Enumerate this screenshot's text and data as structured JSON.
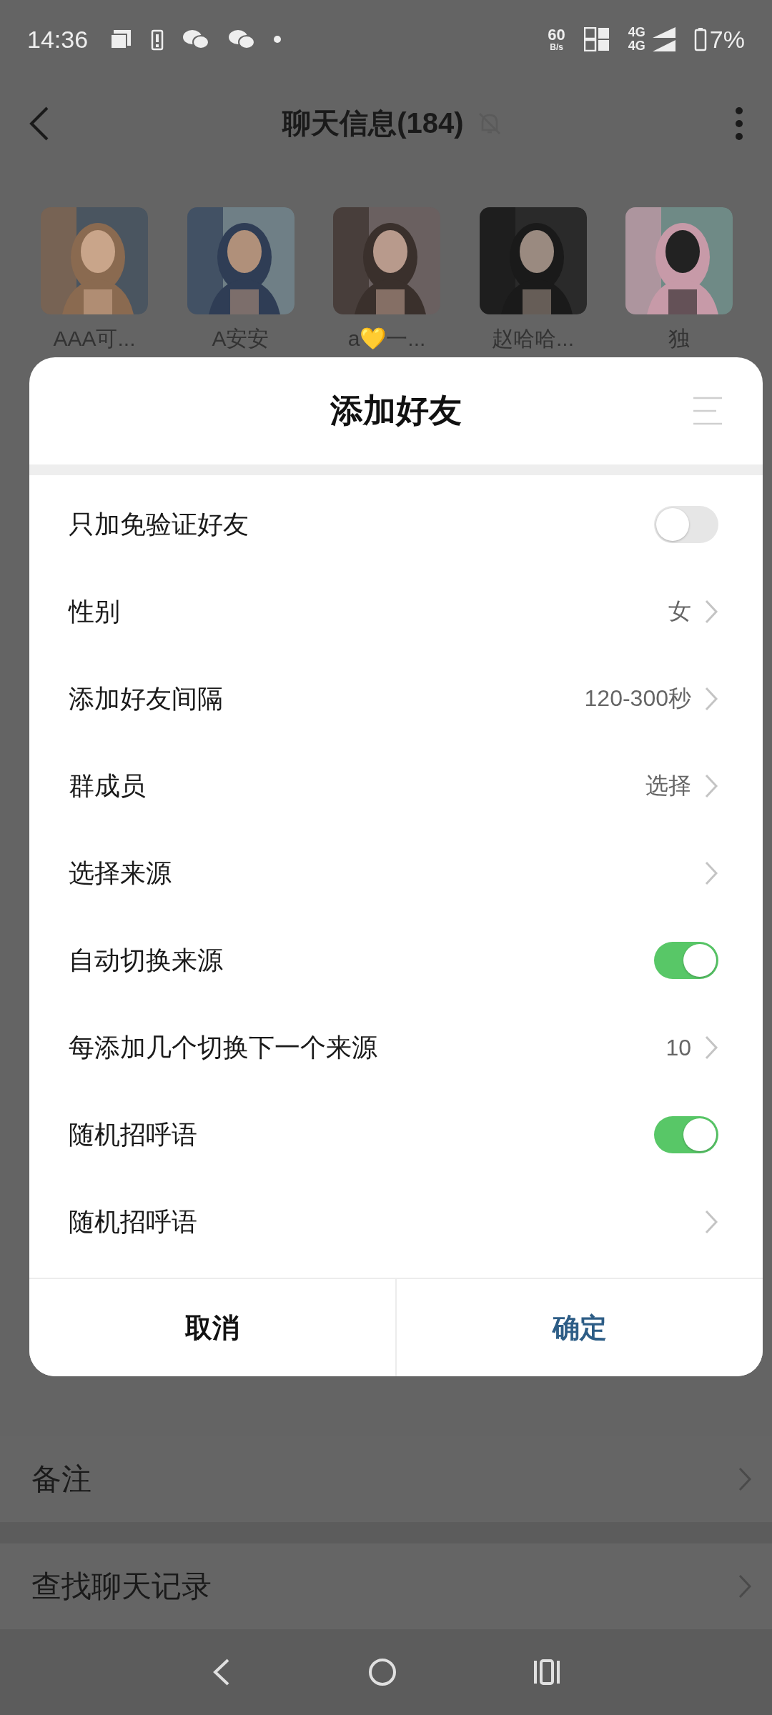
{
  "status_bar": {
    "time": "14:36",
    "speed_value": "60",
    "speed_unit": "B/s",
    "network_1": "4G",
    "network_2": "4G",
    "battery": "7%"
  },
  "top_bar": {
    "title": "聊天信息(184)",
    "muted": true
  },
  "members": [
    {
      "name": "AAA可...",
      "kind": "picture"
    },
    {
      "name": "A安安",
      "kind": "picture"
    },
    {
      "name": "a💛一...",
      "kind": "picture"
    },
    {
      "name": "赵哈哈...",
      "kind": "picture"
    },
    {
      "name": "独",
      "kind": "picture"
    }
  ],
  "dialog": {
    "title": "添加好友",
    "rows": [
      {
        "kind": "toggle",
        "label": "只加免验证好友",
        "on": false
      },
      {
        "kind": "link",
        "label": "性别",
        "value": "女"
      },
      {
        "kind": "link",
        "label": "添加好友间隔",
        "value": "120-300秒"
      },
      {
        "kind": "link",
        "label": "群成员",
        "value": "选择"
      },
      {
        "kind": "link",
        "label": "选择来源"
      },
      {
        "kind": "toggle",
        "label": "自动切换来源",
        "on": true
      },
      {
        "kind": "link",
        "label": "每添加几个切换下一个来源",
        "value": "10"
      },
      {
        "kind": "toggle",
        "label": "随机招呼语",
        "on": true
      },
      {
        "kind": "link",
        "label": "随机招呼语"
      }
    ],
    "buttons": [
      {
        "label": "取消",
        "kind": "cancel"
      },
      {
        "label": "确定",
        "kind": "confirm"
      }
    ]
  },
  "settings": [
    {
      "label": "备注"
    },
    {
      "label": "查找聊天记录"
    }
  ]
}
